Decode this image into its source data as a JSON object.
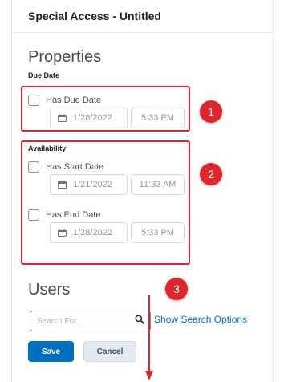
{
  "dialog": {
    "title": "Special Access - Untitled"
  },
  "properties": {
    "heading": "Properties",
    "due_date": {
      "label": "Due Date",
      "checkbox_label": "Has Due Date",
      "checked": false,
      "date": "1/28/2022",
      "time": "5:33 PM"
    },
    "availability": {
      "label": "Availability",
      "start": {
        "checkbox_label": "Has Start Date",
        "checked": false,
        "date": "1/21/2022",
        "time": "11:33 AM"
      },
      "end": {
        "checkbox_label": "Has End Date",
        "checked": false,
        "date": "1/28/2022",
        "time": "5:33 PM"
      }
    }
  },
  "users": {
    "heading": "Users",
    "search_placeholder": "Search For...",
    "search_value": "",
    "show_search_options": "Show Search Options"
  },
  "buttons": {
    "save": "Save",
    "cancel": "Cancel"
  },
  "annotations": [
    "1",
    "2",
    "3"
  ],
  "colors": {
    "annotation_red": "#e0262c",
    "primary_blue": "#006fbf",
    "link_blue": "#006fbf"
  },
  "icons": {
    "date": "calendar-icon",
    "search": "magnifier-icon"
  }
}
